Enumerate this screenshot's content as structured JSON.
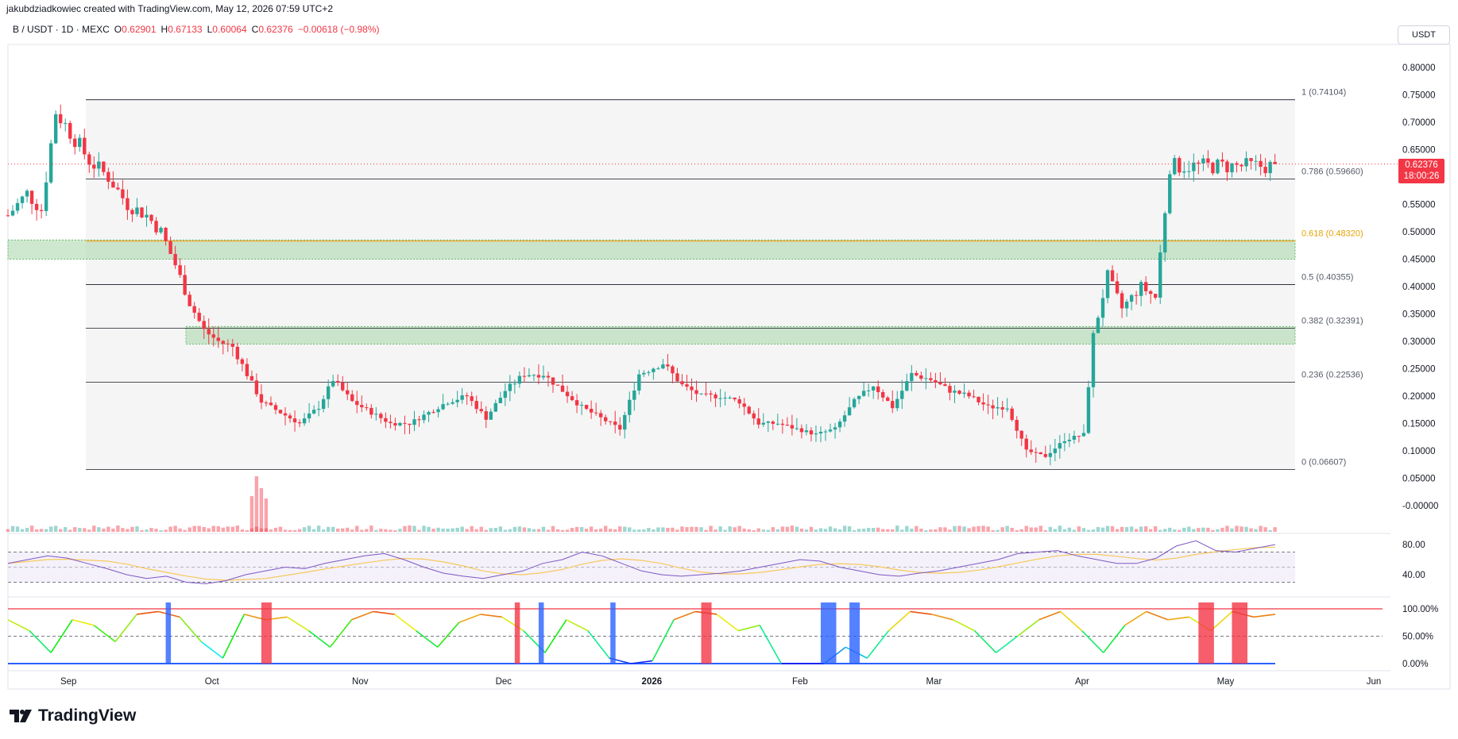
{
  "header": {
    "created_by": "jakubdziadkowiec created with TradingView.com, May 12, 2026 07:59 UTC+2"
  },
  "ohlc": {
    "symbol": "B / USDT · 1D · MEXC",
    "o_label": "O",
    "o": "0.62901",
    "h_label": "H",
    "h": "0.67133",
    "l_label": "L",
    "l": "0.60064",
    "c_label": "C",
    "c": "0.62376",
    "chg": "−0.00618 (−0.98%)"
  },
  "currency_button": "USDT",
  "last_price": {
    "price": "0.62376",
    "countdown": "18:00:26"
  },
  "logo_text": "TradingView",
  "colors": {
    "up": "#26a69a",
    "down": "#f23645",
    "fib_gold": "#f5a623",
    "zone": "#a5d6a7",
    "rsi_line": "#7e57c2",
    "rsi_ma": "#f7c95c"
  },
  "chart_data": [
    {
      "type": "candlestick",
      "title": "B / USDT · 1D · MEXC",
      "ylim": [
        -0.05,
        0.85
      ],
      "y_ticks": [
        "0.80000",
        "0.75000",
        "0.70000",
        "0.65000",
        "0.60000",
        "0.55000",
        "0.50000",
        "0.45000",
        "0.40000",
        "0.35000",
        "0.30000",
        "0.25000",
        "0.20000",
        "0.15000",
        "0.10000",
        "0.05000",
        "-0.00000"
      ],
      "x_ticks": [
        "Sep",
        "Oct",
        "Nov",
        "Dec",
        "2026",
        "Feb",
        "Mar",
        "Apr",
        "May",
        "Jun"
      ],
      "close_path": [
        [
          "2025-08-20",
          0.53
        ],
        [
          "2025-08-24",
          0.57
        ],
        [
          "2025-08-27",
          0.54
        ],
        [
          "2025-08-30",
          0.72
        ],
        [
          "2025-09-03",
          0.67
        ],
        [
          "2025-09-06",
          0.63
        ],
        [
          "2025-09-10",
          0.6
        ],
        [
          "2025-09-14",
          0.55
        ],
        [
          "2025-09-18",
          0.53
        ],
        [
          "2025-09-21",
          0.5
        ],
        [
          "2025-09-24",
          0.44
        ],
        [
          "2025-09-27",
          0.37
        ],
        [
          "2025-09-30",
          0.32
        ],
        [
          "2025-10-03",
          0.3
        ],
        [
          "2025-10-06",
          0.29
        ],
        [
          "2025-10-09",
          0.24
        ],
        [
          "2025-10-12",
          0.19
        ],
        [
          "2025-10-16",
          0.17
        ],
        [
          "2025-10-20",
          0.15
        ],
        [
          "2025-10-24",
          0.18
        ],
        [
          "2025-10-27",
          0.23
        ],
        [
          "2025-10-31",
          0.19
        ],
        [
          "2025-11-04",
          0.17
        ],
        [
          "2025-11-08",
          0.15
        ],
        [
          "2025-11-12",
          0.15
        ],
        [
          "2025-11-16",
          0.17
        ],
        [
          "2025-11-20",
          0.19
        ],
        [
          "2025-11-24",
          0.2
        ],
        [
          "2025-11-28",
          0.16
        ],
        [
          "2025-12-02",
          0.21
        ],
        [
          "2025-12-06",
          0.24
        ],
        [
          "2025-12-10",
          0.24
        ],
        [
          "2025-12-14",
          0.21
        ],
        [
          "2025-12-18",
          0.18
        ],
        [
          "2025-12-22",
          0.16
        ],
        [
          "2025-12-26",
          0.14
        ],
        [
          "2025-12-30",
          0.24
        ],
        [
          "2026-01-04",
          0.26
        ],
        [
          "2026-01-08",
          0.22
        ],
        [
          "2026-01-12",
          0.2
        ],
        [
          "2026-01-16",
          0.2
        ],
        [
          "2026-01-20",
          0.19
        ],
        [
          "2026-01-24",
          0.15
        ],
        [
          "2026-01-28",
          0.15
        ],
        [
          "2026-02-01",
          0.14
        ],
        [
          "2026-02-05",
          0.13
        ],
        [
          "2026-02-09",
          0.14
        ],
        [
          "2026-02-13",
          0.19
        ],
        [
          "2026-02-17",
          0.22
        ],
        [
          "2026-02-21",
          0.18
        ],
        [
          "2026-02-25",
          0.24
        ],
        [
          "2026-03-01",
          0.23
        ],
        [
          "2026-03-05",
          0.21
        ],
        [
          "2026-03-09",
          0.2
        ],
        [
          "2026-03-13",
          0.18
        ],
        [
          "2026-03-17",
          0.18
        ],
        [
          "2026-03-21",
          0.1
        ],
        [
          "2026-03-25",
          0.09
        ],
        [
          "2026-03-29",
          0.12
        ],
        [
          "2026-04-02",
          0.13
        ],
        [
          "2026-04-04",
          0.31
        ],
        [
          "2026-04-07",
          0.42
        ],
        [
          "2026-04-10",
          0.36
        ],
        [
          "2026-04-14",
          0.4
        ],
        [
          "2026-04-17",
          0.38
        ],
        [
          "2026-04-20",
          0.62
        ]
      ],
      "fib_levels": [
        {
          "label": "1 (0.74104)",
          "value": 0.74104
        },
        {
          "label": "0.786 (0.59660)",
          "value": 0.5966
        },
        {
          "label": "0.618 (0.48320)",
          "value": 0.4832
        },
        {
          "label": "0.5 (0.40355)",
          "value": 0.40355
        },
        {
          "label": "0.382 (0.32391)",
          "value": 0.32391
        },
        {
          "label": "0.236 (0.22536)",
          "value": 0.22536
        },
        {
          "label": "0 (0.06607)",
          "value": 0.06607
        }
      ],
      "zones": [
        [
          0.45,
          0.485
        ],
        [
          0.295,
          0.327
        ]
      ],
      "last_price": 0.62376
    },
    {
      "type": "line",
      "series": [
        {
          "values": [
            55,
            60,
            65,
            62,
            55,
            48,
            40,
            35,
            38,
            30,
            28,
            32,
            40,
            45,
            50,
            48,
            55,
            60,
            65,
            68,
            60,
            50,
            42,
            38,
            35,
            40,
            45,
            55,
            60,
            70,
            65,
            55,
            45,
            40,
            38,
            40,
            42,
            45,
            50,
            55,
            60,
            58,
            50,
            45,
            40,
            38,
            42,
            45,
            50,
            55,
            60,
            68,
            70,
            72,
            65,
            60,
            55,
            55,
            62,
            78,
            85,
            72,
            70,
            75,
            80
          ]
        }
      ],
      "y_ticks": [
        "80.00",
        "40.00"
      ],
      "ylim": [
        20,
        90
      ]
    },
    {
      "type": "line",
      "series": [
        {
          "values": [
            80,
            60,
            20,
            80,
            70,
            40,
            90,
            95,
            85,
            40,
            10,
            90,
            80,
            85,
            60,
            30,
            80,
            95,
            90,
            60,
            30,
            75,
            90,
            85,
            60,
            20,
            80,
            60,
            10,
            0,
            5,
            80,
            95,
            90,
            60,
            70,
            0,
            0,
            0,
            30,
            10,
            60,
            95,
            90,
            80,
            60,
            20,
            50,
            80,
            95,
            60,
            20,
            70,
            95,
            80,
            85,
            60,
            95,
            85,
            90
          ]
        }
      ],
      "y_ticks": [
        "100.00%",
        "50.00%",
        "0.00%"
      ],
      "ylim": [
        0,
        100
      ]
    }
  ]
}
